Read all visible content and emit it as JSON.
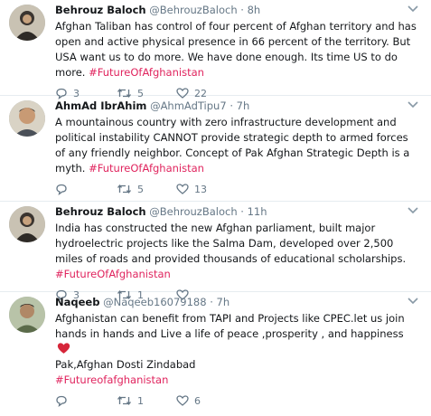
{
  "tweets": [
    {
      "name": "Behrouz Baloch",
      "handle": "@BehrouzBaloch",
      "time": "· 8h",
      "text": "Afghan Taliban has control of four percent of Afghan territory and has open and active physical presence in 66 percent of the territory. But USA want us to do more. We have done enough. Its time US to do more.",
      "hashtag": "#FutureOfAfghanistan",
      "replies": "3",
      "retweets": "5",
      "likes": "22"
    },
    {
      "name": "AhmAd IbrAhim",
      "handle": "@AhmAdTipu7",
      "time": "· 7h",
      "text": "A mountainous country with zero infrastructure development and political instability  CANNOT provide strategic depth to armed forces of any friendly neighbor. Concept of Pak Afghan Strategic Depth is a myth.",
      "hashtag": "#FutureOfAfghanistan",
      "replies": "",
      "retweets": "5",
      "likes": "13"
    },
    {
      "name": "Behrouz Baloch",
      "handle": "@BehrouzBaloch",
      "time": "· 11h",
      "text": "India has constructed the new Afghan parliament, built major hydroelectric projects like the Salma Dam, developed over 2,500 miles of roads and provided thousands of educational scholarships.",
      "hashtag": "#FutureOfAfghanistan",
      "replies": "3",
      "retweets": "1",
      "likes": ""
    },
    {
      "name": "Naqeeb",
      "handle": "@Naqeeb16079188",
      "time": "· 7h",
      "text": "Afghanistan can benefit from TAPI and Projects like CPEC.let us join hands in hands and Live a life of peace ,prosperity , and happiness",
      "text2": "Pak,Afghan Dosti Zindabad",
      "hashtag": "#Futureofafghanistan",
      "replies": "",
      "retweets": "1",
      "likes": "6"
    }
  ],
  "colors": {
    "hashtag": "#e0245e",
    "muted": "#657786",
    "heart": "#e0245e"
  },
  "icons": [
    "chevron-down-icon",
    "reply-icon",
    "retweet-icon",
    "like-icon",
    "heart-emoji-icon"
  ]
}
